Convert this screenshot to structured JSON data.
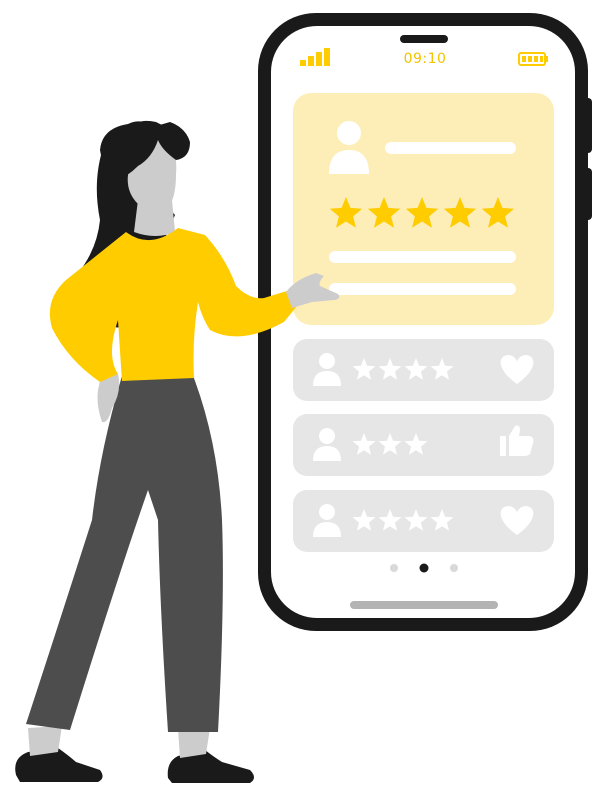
{
  "status_bar": {
    "time": "09:10",
    "signal_icon": "signal-bars-icon",
    "battery_icon": "battery-icon"
  },
  "featured_review": {
    "avatar_icon": "user-avatar-icon",
    "rating": 5,
    "max_rating": 5
  },
  "reviews": [
    {
      "avatar_icon": "user-avatar-icon",
      "rating": 4,
      "action_icon": "heart-icon"
    },
    {
      "avatar_icon": "user-avatar-icon",
      "rating": 3,
      "action_icon": "thumbs-up-icon"
    },
    {
      "avatar_icon": "user-avatar-icon",
      "rating": 4,
      "action_icon": "heart-icon"
    }
  ],
  "pagination": {
    "pages": 3,
    "current": 2
  },
  "colors": {
    "accent": "#ffcc00",
    "accent_light": "#fdeeb8",
    "phone_frame": "#1a1a1a",
    "card_gray": "#e6e6e6",
    "icon_white": "#ffffff",
    "pants": "#4d4d4d",
    "skin": "#cccccc"
  }
}
